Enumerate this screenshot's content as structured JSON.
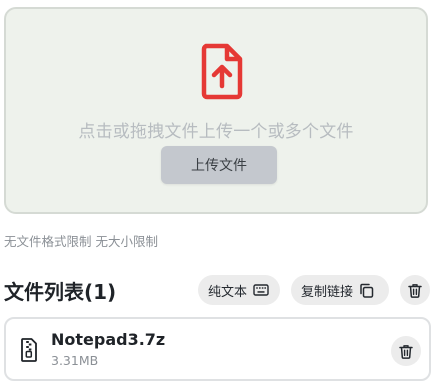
{
  "upload": {
    "hint": "点击或拖拽文件上传一个或多个文件",
    "button_label": "上传文件",
    "icon": "file-upload-icon",
    "accent_color": "#e53935"
  },
  "limit_note": "无文件格式限制 无大小限制",
  "file_list": {
    "title": "文件列表(1)",
    "actions": {
      "plain_text_label": "纯文本",
      "plain_text_icon": "keyboard-icon",
      "copy_link_label": "复制链接",
      "copy_link_icon": "copy-icon",
      "delete_icon": "trash-icon"
    },
    "files": [
      {
        "name": "Notepad3.7z",
        "size": "3.31MB",
        "icon": "zip-file-icon",
        "delete_icon": "trash-icon"
      }
    ]
  }
}
